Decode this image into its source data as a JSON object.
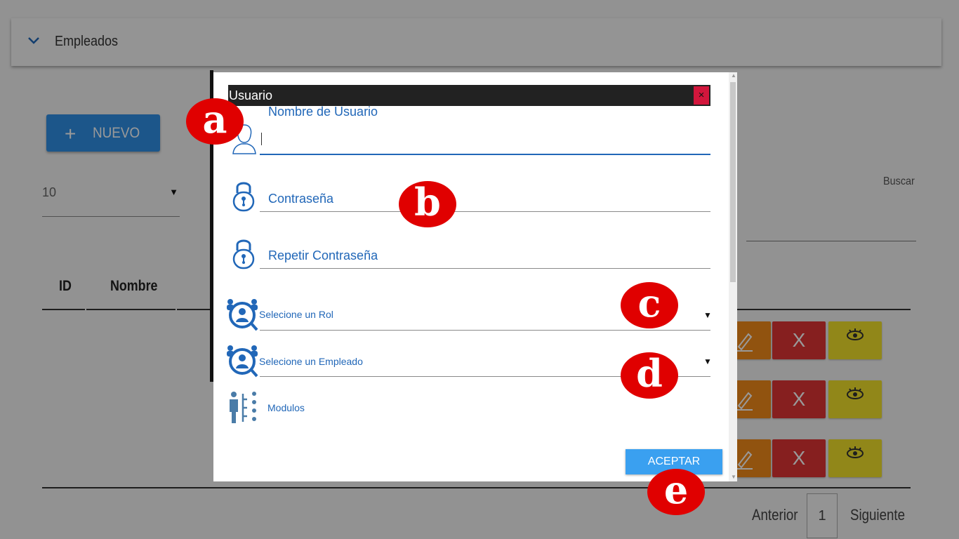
{
  "background": {
    "panel_title": "Empleados",
    "new_button": "NUEVO",
    "page_size": "10",
    "search_label": "Buscar",
    "table_headers": [
      "ID",
      "Nombre"
    ],
    "delete_symbol": "X",
    "pager": {
      "prev": "Anterior",
      "current": "1",
      "next": "Siguiente"
    }
  },
  "modal": {
    "title": "Usuario",
    "close_symbol": "×",
    "fields": {
      "username": "Nombre de Usuario",
      "password": "Contraseña",
      "repeat_password": "Repetir Contraseña",
      "role_select": "Selecione un Rol",
      "employee_select": "Selecione un Empleado",
      "modules": "Modulos"
    },
    "accept_button": "ACEPTAR"
  },
  "annotations": [
    "a",
    "b",
    "c",
    "d",
    "e"
  ],
  "colors": {
    "primary_blue": "#2167b8",
    "button_blue": "#3aa0f0",
    "close_red": "#d2163c",
    "marker_red": "#e00000",
    "edit_orange": "#f28a1a",
    "delete_red": "#e03434",
    "view_yellow": "#f2e12a"
  },
  "icons": [
    "chevron-down-icon",
    "plus-icon",
    "user-icon",
    "lock-icon",
    "role-icon",
    "employee-icon",
    "modules-icon",
    "pencil-icon",
    "eye-icon",
    "close-icon"
  ]
}
